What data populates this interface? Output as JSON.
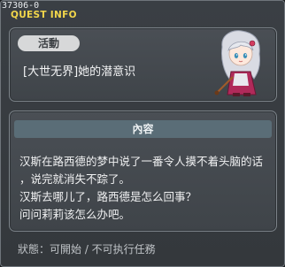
{
  "window": {
    "quest_id": "37306-0",
    "title": "QUEST INFO"
  },
  "quest": {
    "category_badge": "活動",
    "name": "[大世无界]她的潜意识",
    "npc_icon": "npc-portrait-white-haired-girl"
  },
  "content": {
    "header": "內容",
    "lines": [
      "汉斯在路西德的梦中说了一番令人摸不着头脑的话",
      "，说完就消失不踪了。",
      "汉斯去哪儿了，路西德是怎么回事？",
      "问问莉莉该怎么办吧。"
    ]
  },
  "footer": {
    "status": "狀態：可開始 / 不可执行任務"
  },
  "colors": {
    "title": "#f2d64b",
    "header_bar": "#5a6d77",
    "badge": "#d7d8d9"
  }
}
